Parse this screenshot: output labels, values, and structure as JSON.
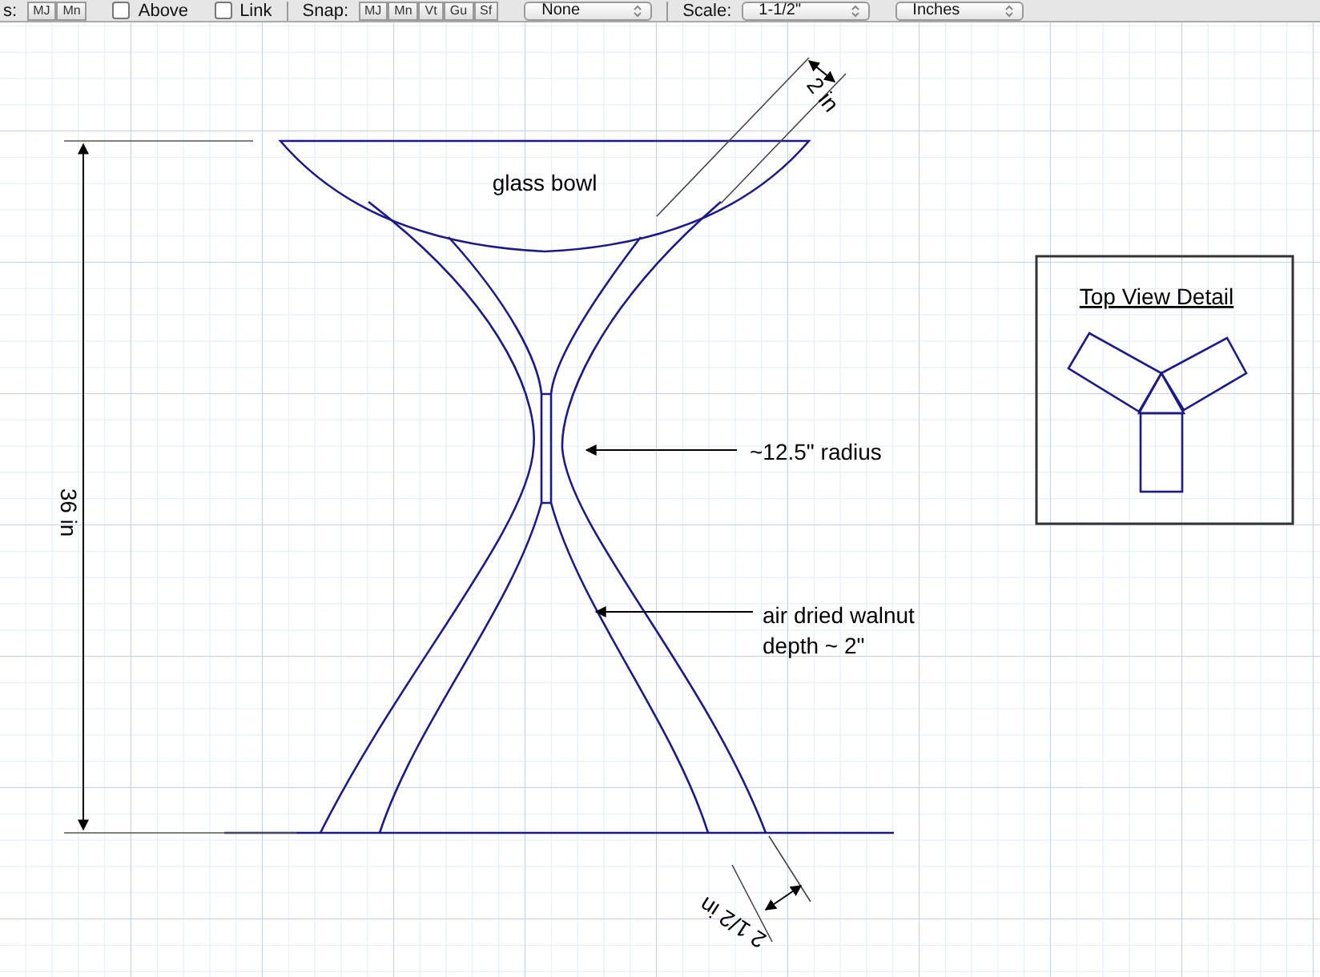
{
  "toolbar": {
    "cut_label": "s:",
    "first_segments": [
      {
        "label": "MJ",
        "selected": false
      },
      {
        "label": "Mn",
        "selected": false
      }
    ],
    "checkboxes": [
      {
        "label": "Above",
        "checked": false
      },
      {
        "label": "Link",
        "checked": false
      }
    ],
    "snap_label": "Snap:",
    "snap_segments": [
      {
        "label": "MJ",
        "selected": false
      },
      {
        "label": "Mn",
        "selected": false
      },
      {
        "label": "Vt",
        "selected": false
      },
      {
        "label": "Gu",
        "selected": false
      },
      {
        "label": "Sf",
        "selected": false
      }
    ],
    "snap_dropdown": "None",
    "scale_label": "Scale:",
    "scale_dropdown": "1-1/2\"",
    "units_dropdown": "Inches"
  },
  "drawing": {
    "bowl_label": "glass bowl",
    "height_dimension": "36 in",
    "top_dimension": "2 in",
    "bottom_dimension": "2 1/2 in",
    "radius_note": "~12.5\" radius",
    "wood_note": [
      "air dried walnut",
      "depth ~ 2\""
    ]
  },
  "detail": {
    "title": "Top View Detail"
  }
}
